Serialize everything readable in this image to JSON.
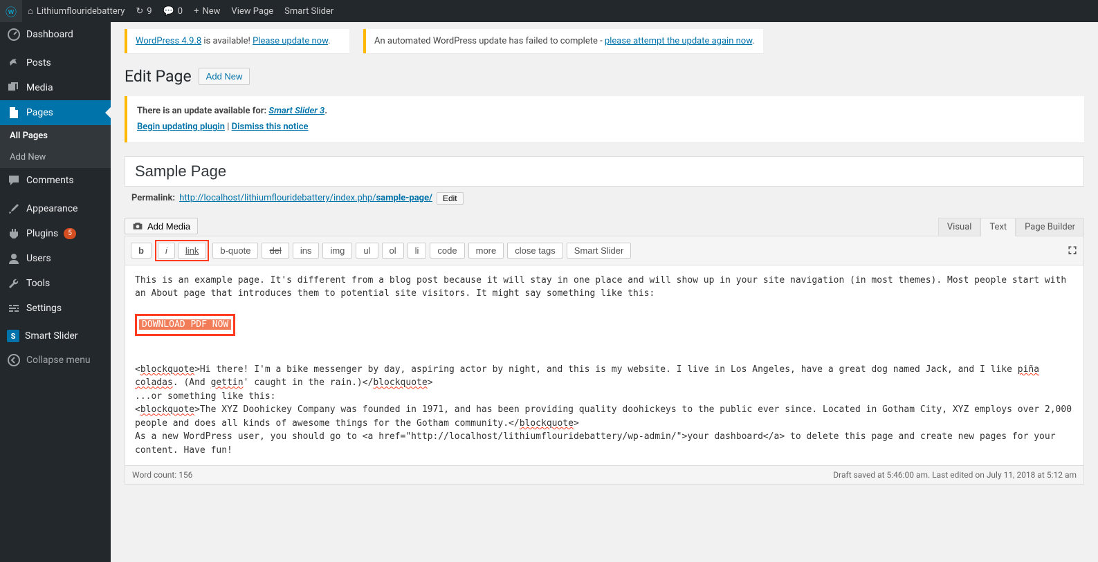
{
  "toolbar": {
    "site_name": "Lithiumflouridebattery",
    "updates_count": "9",
    "comments_count": "0",
    "new_label": "New",
    "view_page": "View Page",
    "smart_slider": "Smart Slider"
  },
  "sidebar": {
    "dashboard": "Dashboard",
    "posts": "Posts",
    "media": "Media",
    "pages": "Pages",
    "all_pages": "All Pages",
    "add_new": "Add New",
    "comments": "Comments",
    "appearance": "Appearance",
    "plugins": "Plugins",
    "plugins_badge": "5",
    "users": "Users",
    "tools": "Tools",
    "settings": "Settings",
    "smart_slider": "Smart Slider",
    "collapse": "Collapse menu"
  },
  "notices": {
    "wp_version": "WordPress 4.9.8",
    "available_text": " is available! ",
    "update_now": "Please update now",
    "auto_fail_text": "An automated WordPress update has failed to complete - ",
    "auto_fail_link": "please attempt the update again now",
    "plugin_update_prefix": "There is an update available for: ",
    "plugin_name": "Smart Slider 3",
    "begin_update": "Begin updating plugin",
    "dismiss": "Dismiss this notice"
  },
  "heading": {
    "title": "Edit Page",
    "add_new": "Add New"
  },
  "page": {
    "title": "Sample Page",
    "permalink_label": "Permalink:",
    "permalink_base": "http://localhost/lithiumflouridebattery/index.php/",
    "permalink_slug": "sample-page/",
    "edit_btn": "Edit"
  },
  "editor": {
    "add_media": "Add Media",
    "tabs": {
      "visual": "Visual",
      "text": "Text",
      "page_builder": "Page Builder"
    },
    "buttons": {
      "b": "b",
      "i": "i",
      "link": "link",
      "bquote": "b-quote",
      "del": "del",
      "ins": "ins",
      "img": "img",
      "ul": "ul",
      "ol": "ol",
      "li": "li",
      "code": "code",
      "more": "more",
      "close": "close tags",
      "smart": "Smart Slider"
    },
    "content": {
      "p1": "This is an example page. It's different from a blog post because it will stay in one place and will show up in your site navigation (in most themes). Most people start with an About page that introduces them to potential site visitors. It might say something like this:",
      "download": "DOWNLOAD PDF NOW",
      "bq1_pre": "<",
      "bq1_word": "blockquote",
      "bq1_text": ">Hi there! I'm a bike messenger by day, aspiring actor by night, and this is my website. I live in Los Angeles, have a great dog named Jack, and I like ",
      "pina": "piña",
      "coladas": "coladas",
      "bq1_mid": ". (And ",
      "gettin": "gettin",
      "bq1_end": "' caught in the rain.)</",
      "bq1_close": "blockquote",
      "or_text": "...or something like this:",
      "bq2_pre": "<",
      "bq2_text": ">The XYZ Doohickey Company was founded in 1971, and has been providing quality doohickeys to the public ever since. Located in Gotham City, XYZ employs over 2,000 people and does all kinds of awesome things for the Gotham community.</",
      "p3": "As a new WordPress user, you should go to <a href=\"http://localhost/lithiumflouridebattery/wp-admin/\">your dashboard</a> to delete this page and create new pages for your content. Have fun!"
    }
  },
  "status": {
    "word_count_label": "Word count: ",
    "word_count": "156",
    "draft_saved": "Draft saved at 5:46:00 am. Last edited on July 11, 2018 at 5:12 am"
  }
}
